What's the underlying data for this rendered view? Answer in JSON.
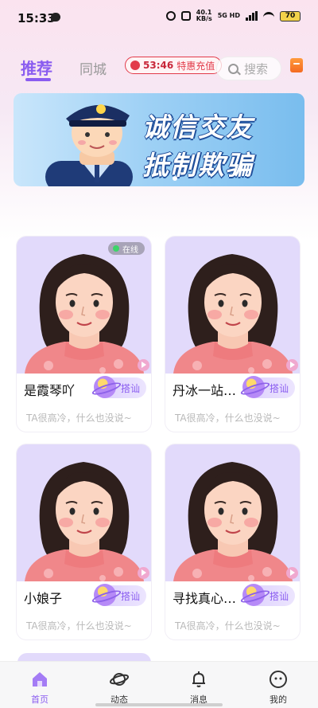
{
  "status_bar": {
    "time": "15:33",
    "net_speed_value": "40.1",
    "net_speed_unit": "KB/s",
    "signal_label": "5G HD",
    "battery": "70"
  },
  "top_nav": {
    "tabs": [
      {
        "label": "推荐",
        "active": true
      },
      {
        "label": "同城",
        "active": false
      }
    ],
    "promo": {
      "timer": "53:46",
      "label": "特惠充值"
    },
    "search_placeholder": "搜索",
    "accent_color": "#8a5cf0"
  },
  "banner": {
    "line1": "诚信交友",
    "line2": "抵制欺骗"
  },
  "cards": [
    {
      "name": "是霞琴吖",
      "bio": "TA很高冷，什么也没说~",
      "online": true,
      "online_label": "在线",
      "button": "搭讪"
    },
    {
      "name": "丹冰一站…",
      "bio": "TA很高冷，什么也没说~",
      "online": false,
      "button": "搭讪"
    },
    {
      "name": "小娘子",
      "bio": "TA很高冷，什么也没说~",
      "online": false,
      "button": "搭讪"
    },
    {
      "name": "寻找真心…",
      "bio": "TA很高冷，什么也没说~",
      "online": false,
      "button": "搭讪"
    }
  ],
  "bottom_nav": [
    {
      "label": "首页",
      "icon": "home-icon",
      "active": true
    },
    {
      "label": "动态",
      "icon": "planet-icon",
      "active": false
    },
    {
      "label": "消息",
      "icon": "bell-icon",
      "active": false
    },
    {
      "label": "我的",
      "icon": "profile-icon",
      "active": false
    }
  ]
}
